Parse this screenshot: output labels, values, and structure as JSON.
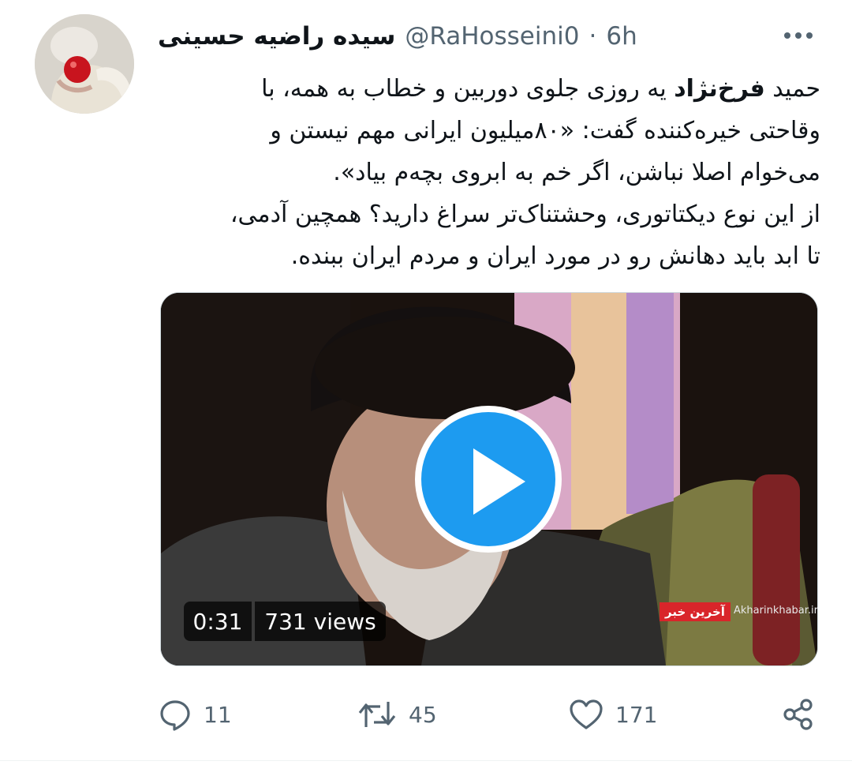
{
  "tweet": {
    "author_name": "سیده راضیه حسینی",
    "handle": "@RaHosseini0",
    "separator": "·",
    "time": "6h",
    "text_intro": "حمید ",
    "text_bold": "فرخ‌نژاد",
    "text_rest": " یه روزی جلوی دوربین و خطاب به همه، با\nوقاحتی خیره‌کننده گفت: «۸۰میلیون ایرانی مهم نیستن و\nمی‌خوام اصلا نباشن، اگر خم به ابروی بچه‌م بیاد».\nاز این نوع دیکتاتوری، وحشتناک‌تر سراغ دارید؟ همچین آدمی،\nتا ابد باید دهانش رو در مورد ایران و مردم ایران ببنده."
  },
  "media": {
    "duration": "0:31",
    "views": "731 views",
    "watermark_logo": "آخرین خبر",
    "watermark_url": "Akharinkhabar.ir"
  },
  "actions": {
    "reply_count": "11",
    "retweet_count": "45",
    "like_count": "171"
  },
  "colors": {
    "accent": "#1d9bf0",
    "secondary_text": "#536471",
    "primary_text": "#0f1419"
  },
  "icons": [
    "more-icon",
    "play-icon",
    "reply-icon",
    "retweet-icon",
    "like-icon",
    "share-icon"
  ]
}
